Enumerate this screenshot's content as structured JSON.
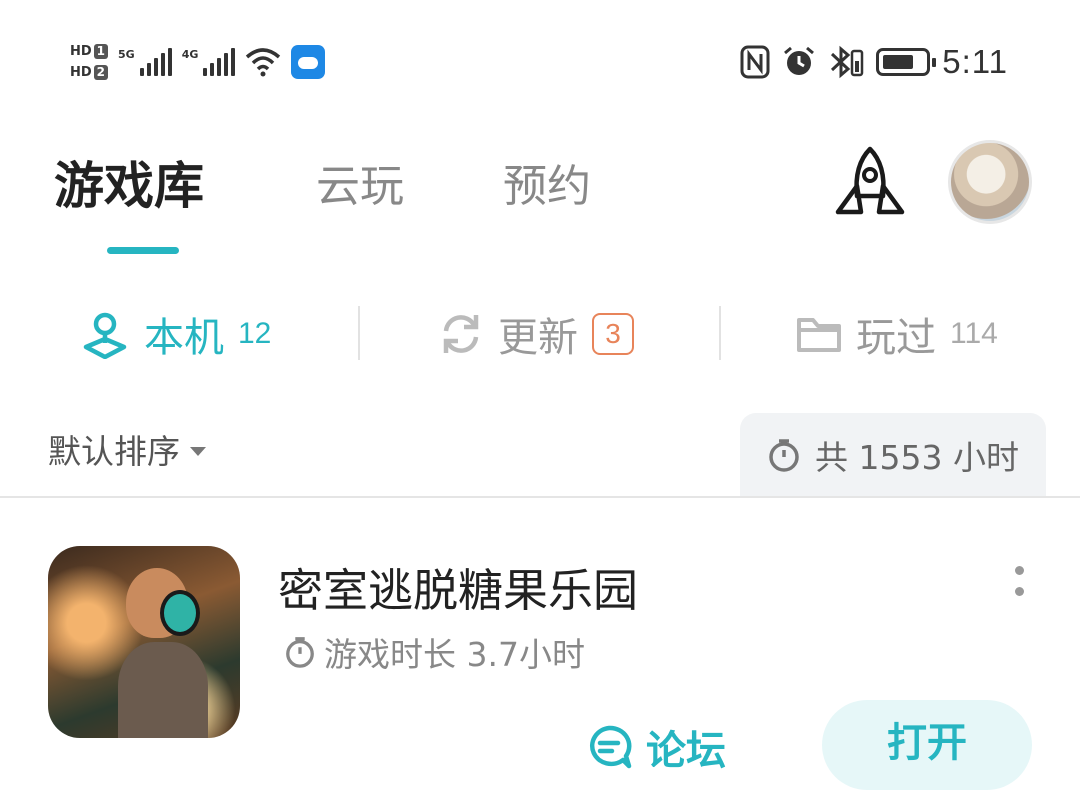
{
  "status_bar": {
    "sim1": "HD",
    "sim1_num": "1",
    "sim2": "HD",
    "sim2_num": "2",
    "net1": "5G",
    "net2": "4G",
    "time": "5:11",
    "icons": [
      "nfc-icon",
      "alarm-icon",
      "bluetooth-icon",
      "battery-icon"
    ]
  },
  "top_tabs": [
    {
      "label": "游戏库",
      "active": true
    },
    {
      "label": "云玩"
    },
    {
      "label": "预约"
    }
  ],
  "sub_tabs": [
    {
      "label": "本机",
      "count": "12",
      "active": true
    },
    {
      "label": "更新",
      "badge": "3"
    },
    {
      "label": "玩过",
      "count": "114"
    }
  ],
  "sort": {
    "label": "默认排序"
  },
  "total_playtime": "共 1553 小时",
  "game": {
    "title": "密室逃脱糖果乐园",
    "playtime": "游戏时长 3.7小时",
    "forum_label": "论坛",
    "open_label": "打开"
  },
  "colors": {
    "accent": "#26b5c1",
    "badge": "#e8845a"
  }
}
